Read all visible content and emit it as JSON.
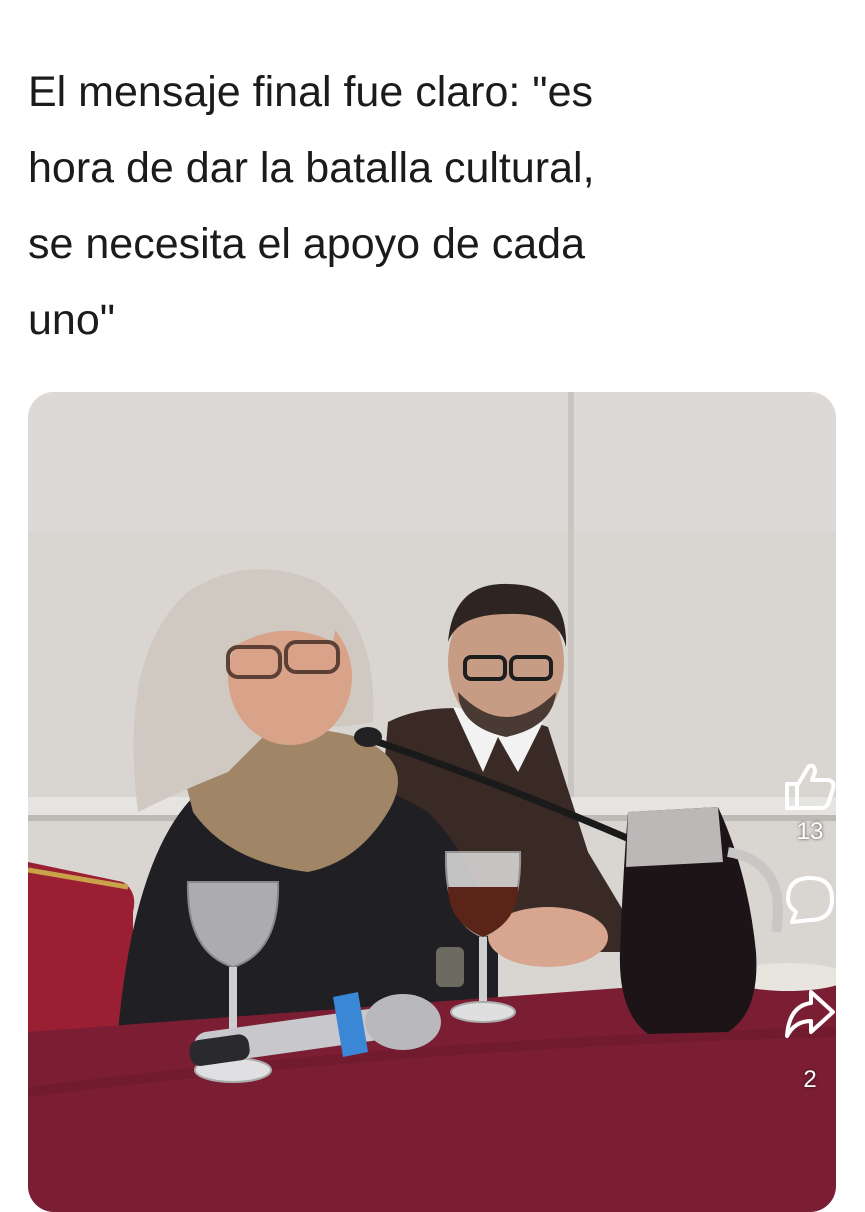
{
  "post": {
    "lines": [
      "El mensaje final fue claro: \"es",
      "hora de dar la batalla cultural,",
      "se necesita el apoyo de cada",
      "uno\""
    ]
  },
  "actions": {
    "like_icon": "thumbs-up-icon",
    "like_count": "13",
    "comment_icon": "comment-bubble-icon",
    "share_icon": "share-arrow-icon",
    "share_count": "2"
  },
  "colors": {
    "tablecloth": "#7b1e33",
    "wall": "#d8d6d3",
    "text": "#1b1b1b"
  }
}
